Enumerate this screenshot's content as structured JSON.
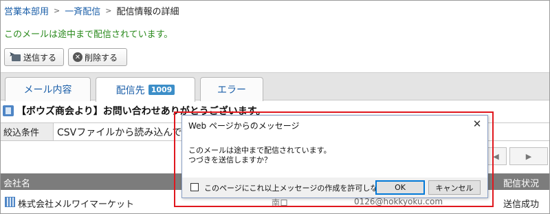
{
  "breadcrumb": {
    "items": [
      "営業本部用",
      "一斉配信"
    ],
    "current": "配信情報の詳細",
    "separator": ">"
  },
  "notice": "このメールは途中まで配信されています。",
  "toolbar": {
    "send_label": "送信する",
    "delete_label": "削除する"
  },
  "tabs": {
    "mail": "メール内容",
    "destinations": "配信先",
    "destinations_count": "1009",
    "error": "エラー"
  },
  "subject": "【ボウズ商会より】お問い合わせありがとうございます。",
  "filter": {
    "label": "絞込条件",
    "value": "CSVファイルから読み込んで"
  },
  "pager": {
    "prev": "◀",
    "next": "▶"
  },
  "grid": {
    "headers": {
      "company": "会社名",
      "status": "配信状況"
    },
    "rows": [
      {
        "company": "株式会社メルワイマーケット",
        "name_partial": "南口",
        "email_partial": "0126@hokkyoku.com",
        "status": "送信成功"
      }
    ]
  },
  "dialog": {
    "title": "Web ページからのメッセージ",
    "close": "✕",
    "line1": "このメールは途中まで配信されています。",
    "line2": "つづきを送信しますか？",
    "checkbox_label": "このページにこれ以上メッセージの作成を許可しない",
    "ok": "OK",
    "cancel": "キャンセル"
  },
  "colors": {
    "link": "#1a5ea8",
    "notice": "#2a8a1c",
    "highlight": "#e0161d",
    "badge": "#3c8ec8",
    "header_bg": "#7c7c7c"
  }
}
